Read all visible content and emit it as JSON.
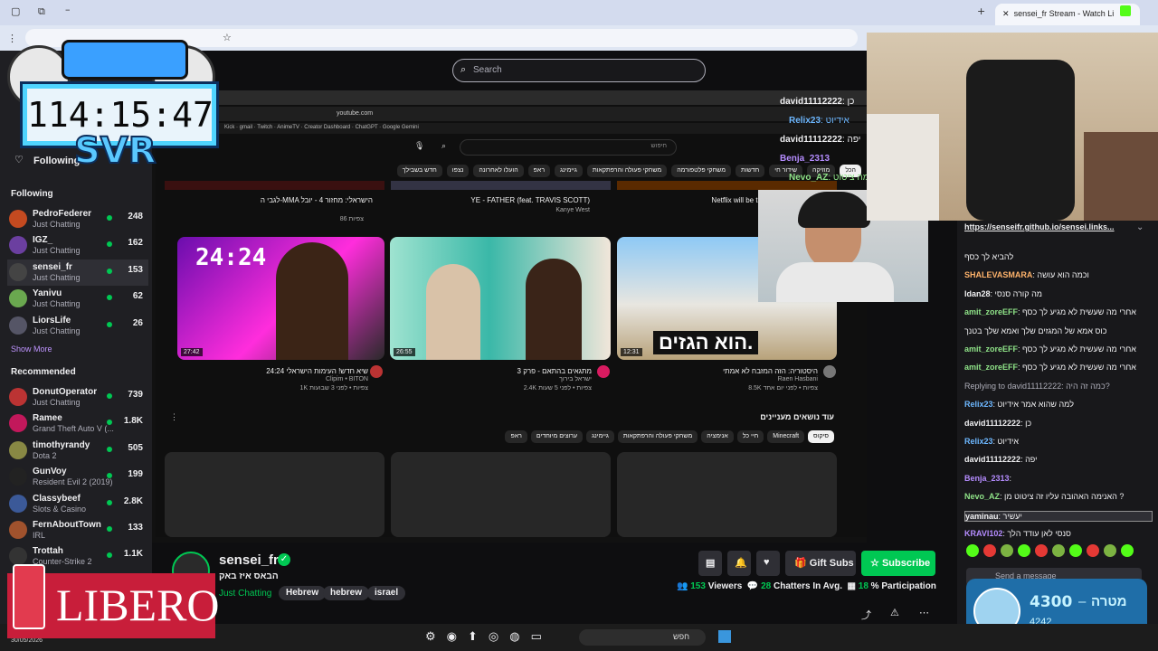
{
  "browser": {
    "tab_title": "sensei_fr Stream - Watch Li",
    "inner_url": "youtube.com"
  },
  "overlay": {
    "timer": "114:15:47",
    "label": "SVR",
    "banner": "LIBERO",
    "date": "30/05/2026",
    "goal_current": "4300",
    "goal_dash": "–",
    "goal_label": "מטרה",
    "goal_sub": "4242"
  },
  "topbar": {
    "search_placeholder": "Search",
    "following_label": "Following"
  },
  "sidebar": {
    "following_heading": "Following",
    "following": [
      {
        "name": "PedroFederer",
        "game": "Just Chatting",
        "viewers": "248",
        "color": "#c44a20"
      },
      {
        "name": "IGZ_",
        "game": "Just Chatting",
        "viewers": "162",
        "color": "#6b3fa0"
      },
      {
        "name": "sensei_fr",
        "game": "Just Chatting",
        "viewers": "153",
        "color": "#444"
      },
      {
        "name": "Yanivu",
        "game": "Just Chatting",
        "viewers": "62",
        "color": "#6aa84f"
      },
      {
        "name": "LiorsLife",
        "game": "Just Chatting",
        "viewers": "26",
        "color": "#556"
      }
    ],
    "show_more": "Show More",
    "recommended_heading": "Recommended",
    "recommended": [
      {
        "name": "DonutOperator",
        "game": "Just Chatting",
        "viewers": "739",
        "color": "#b33"
      },
      {
        "name": "Ramee",
        "game": "Grand Theft Auto V (...",
        "viewers": "1.8K",
        "color": "#c2185b"
      },
      {
        "name": "timothyrandy",
        "game": "Dota 2",
        "viewers": "505",
        "color": "#884"
      },
      {
        "name": "GunVoy",
        "game": "Resident Evil 2 (2019)",
        "viewers": "199",
        "color": "#222"
      },
      {
        "name": "Classybeef",
        "game": "Slots & Casino",
        "viewers": "2.8K",
        "color": "#3b5998"
      },
      {
        "name": "FernAboutTown",
        "game": "IRL",
        "viewers": "133",
        "color": "#a0522d"
      },
      {
        "name": "Trottah",
        "game": "Counter-Strike 2",
        "viewers": "1.1K",
        "color": "#333"
      }
    ]
  },
  "youtube": {
    "search_placeholder": "חיפוש",
    "chips": [
      "הכל",
      "מוזיקה",
      "שידור חי",
      "חדשות",
      "משחקי פלטפורמה",
      "משחקי פעולה והרפתקאות",
      "גיימינג",
      "ראפ",
      "הועלו לאחרונה",
      "נצפו",
      "חדש בשבילך"
    ],
    "top_row": [
      {
        "title": "לגבי ה-MMA הישראלי: מחזור 4 - יובל",
        "meta": "86 צפיות"
      },
      {
        "title": "YE - FATHER (feat. TRAVIS SCOTT)",
        "meta": "Kanye West"
      },
      {
        "title": "Netflix will be th",
        "meta": ""
      }
    ],
    "videos": [
      {
        "title": "שיא חדש! העימות הישראלי 24:24",
        "channel": "Clipim • BITON",
        "meta": "1K צפיות • לפני 3 שבועות",
        "duration": "27:42",
        "overlay": "24:24"
      },
      {
        "title": "מתגאים בהתאם - פרק 3",
        "channel": "ישראל בירוך",
        "meta": "2.4K צפיות • לפני 5 שעות",
        "duration": "26:55",
        "overlay": ""
      },
      {
        "title": "היסטוריה: הזה המזבח לא אמתי",
        "channel": "Raen Hasbani",
        "meta": "8.5K צפיות • לפני יום אחד",
        "duration": "12:31",
        "overlay": "הוא הגזים."
      }
    ],
    "section_title": "עוד נושאים מעניינים",
    "section_chips": [
      "סיקוס",
      "Minecraft",
      "חיי כל",
      "אנימציה",
      "משחקי פעולה והרפתקאות",
      "גיימינג",
      "ערוצים מיוחדים",
      "ראפ"
    ],
    "side_links": [
      "בית",
      "הספריה",
      "פלייליסטים",
      "לצפייה בהמשך",
      "סרטונים שאהבתי",
      "הסרטונים שלך",
      "הורדות",
      "תכנים נוספים"
    ]
  },
  "channel": {
    "name": "sensei_fr",
    "title": "הבאס איז באק",
    "category": "Just Chatting",
    "tags": [
      "Hebrew",
      "hebrew",
      "israel"
    ],
    "gift_label": "Gift Subs",
    "subscribe_label": "Subscribe",
    "viewers": "153",
    "viewers_label": "Viewers",
    "chatters": "28",
    "chatters_label": "Chatters In Avg.",
    "participation": "18",
    "participation_label": "% Participation"
  },
  "chat": {
    "pinned_link": "https://senseifr.github.io/sensei.links...",
    "messages": [
      {
        "user": "",
        "text": "להביא לך כסף",
        "color": "#efeff1"
      },
      {
        "user": "SHALEVASMARA",
        "text": "וכמה הוא עושה",
        "color": "#ffb36b"
      },
      {
        "user": "Idan28",
        "text": "מה קורה סנסי",
        "color": "#efeff1"
      },
      {
        "user": "amit_zoreEFF",
        "text": "אחרי מה שעשית לא מגיע לך כסף",
        "color": "#8fe388"
      },
      {
        "user": "",
        "text": "כוס אמא של המגזים שלך ואמא שלך בטנך",
        "color": "#efeff1"
      },
      {
        "user": "amit_zoreEFF",
        "text": "אחרי מה שעשית לא מגיע לך כסף",
        "color": "#8fe388"
      },
      {
        "user": "amit_zoreEFF",
        "text": "אחרי מה שעשית לא מגיע לך כסף",
        "color": "#8fe388"
      },
      {
        "user": "",
        "text": "Replying to david11112222: כמה זה היה?",
        "color": "#adadb8"
      },
      {
        "user": "Relix23",
        "text": "למה שהוא אמר אידיוט",
        "color": "#6db7ff"
      },
      {
        "user": "david11112222",
        "text": "כן",
        "color": "#efeff1"
      },
      {
        "user": "Relix23",
        "text": "אידיוט",
        "color": "#6db7ff"
      },
      {
        "user": "david11112222",
        "text": "יפה",
        "color": "#efeff1"
      },
      {
        "user": "Benja_2313",
        "text": "",
        "color": "#b58cff"
      },
      {
        "user": "Nevo_AZ",
        "text": "האנימה האהובה עליו זה ציטוט מן ?",
        "color": "#8fe388"
      },
      {
        "user": "yaminau",
        "text": "יעשיר",
        "color": "#efeff1"
      },
      {
        "user": "KRAVI102",
        "text": "סנסי לאן עודד הלך",
        "color": "#b58cff"
      }
    ],
    "input_placeholder": "Send a message"
  },
  "stream_chat_overlay": [
    {
      "user": "david11112222",
      "text": ": כן"
    },
    {
      "user": "Relix23",
      "text": ": אידיוט"
    },
    {
      "user": "david11112222",
      "text": ": יפה"
    },
    {
      "user": "Benja_2313",
      "text": ""
    },
    {
      "user": "Nevo_AZ",
      "text": ": האנימה ציטוט"
    }
  ],
  "taskbar": {
    "search": "חפש"
  }
}
